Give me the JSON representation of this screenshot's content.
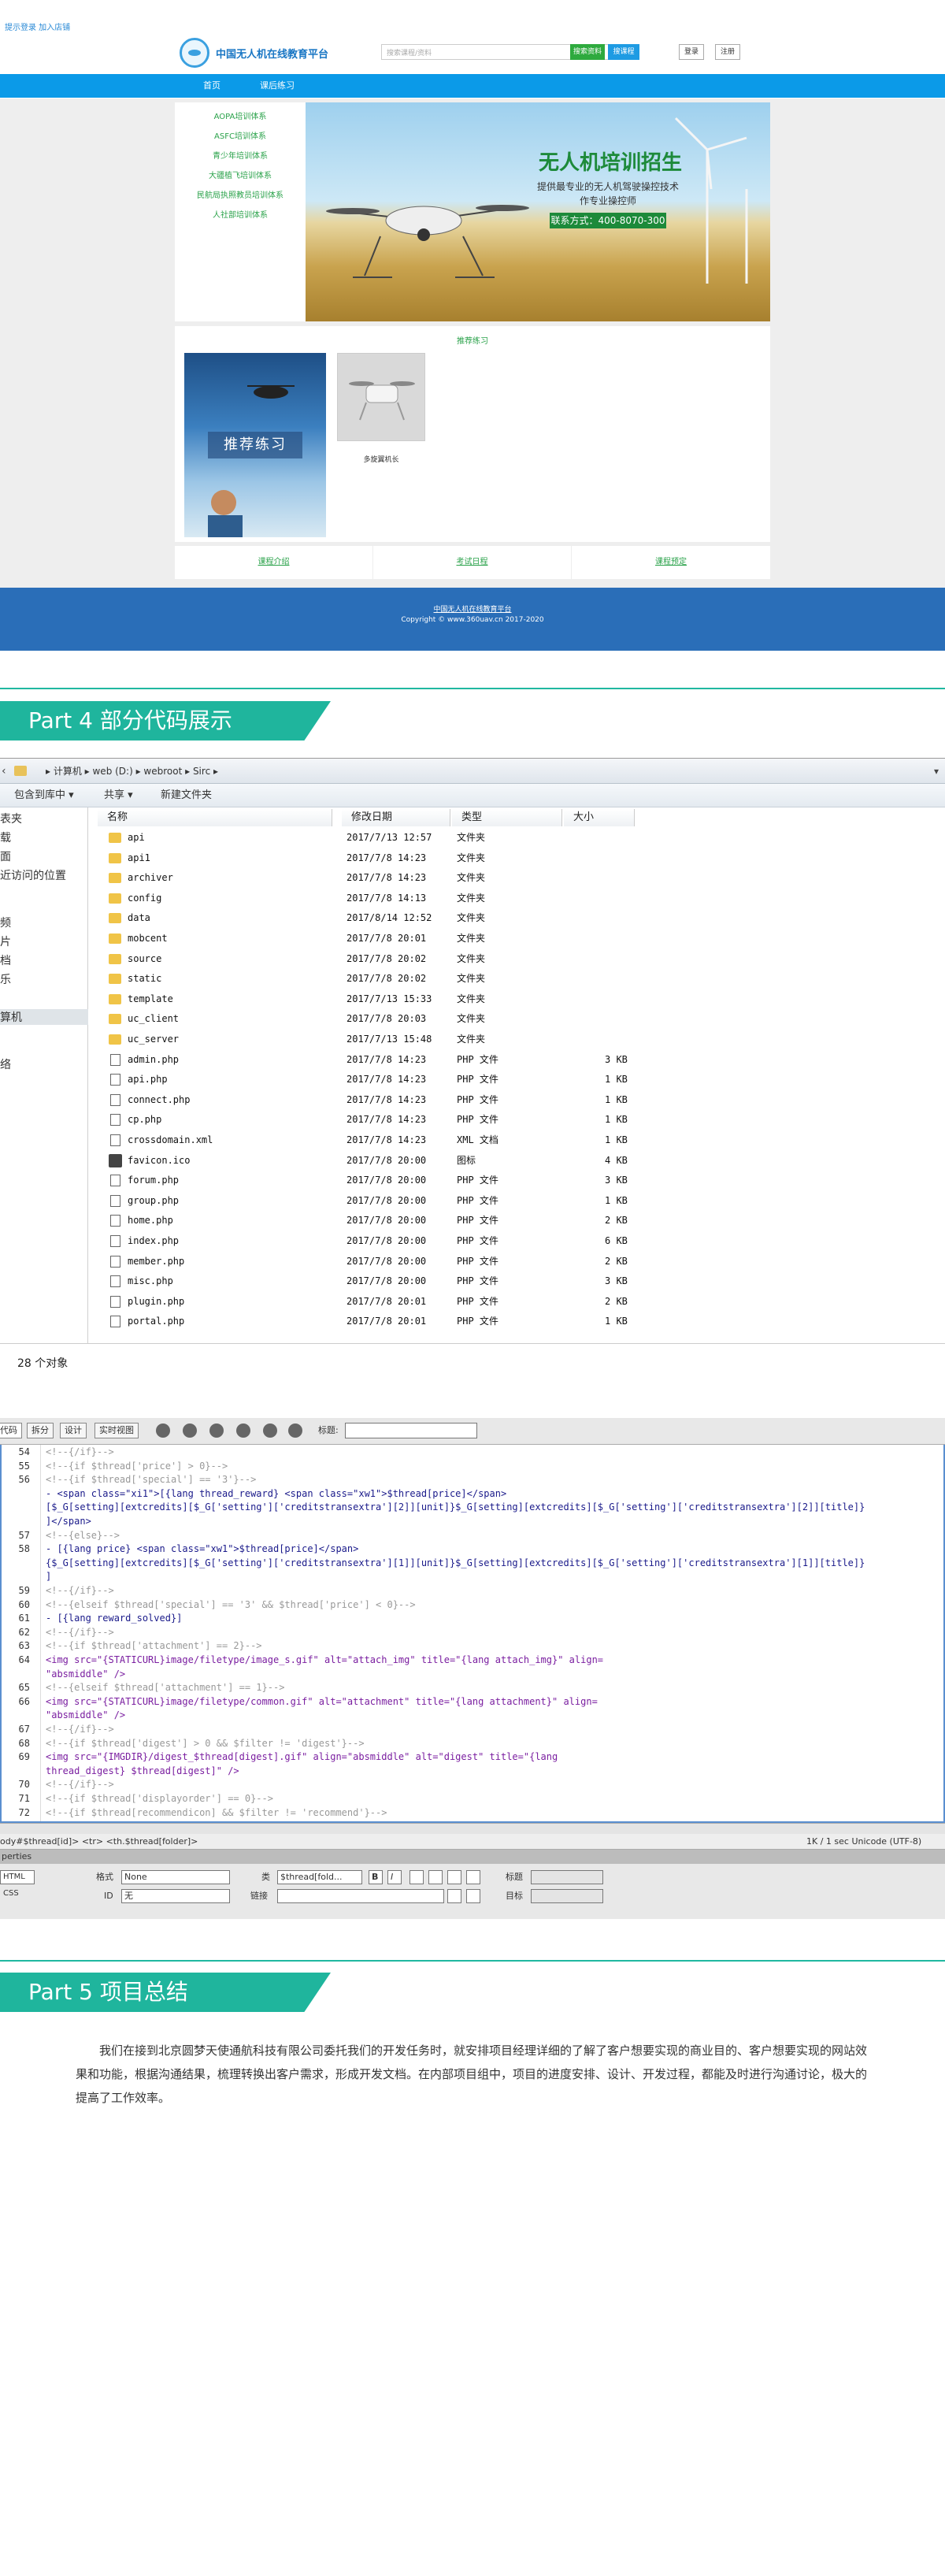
{
  "site": {
    "topbar": "提示登录 加入店铺",
    "logo_text": "中国无人机在线教育平台",
    "search_placeholder": "搜索课程/资料",
    "search_button": "搜索资料",
    "search_button2": "搜课程",
    "login": "登录",
    "register": "注册",
    "nav": [
      "首页",
      "课后练习"
    ],
    "side_menu": [
      "AOPA培训体系",
      "ASFC培训体系",
      "青少年培训体系",
      "大疆植飞培训体系",
      "民航局执照教员培训体系",
      "人社部培训体系"
    ],
    "banner": {
      "title": "无人机培训招生",
      "subtitle1": "提供最专业的无人机驾驶操控技术",
      "subtitle2": "作专业操控师",
      "phone": "联系方式：400-8070-300"
    },
    "recommend_title": "推荐练习",
    "poster_label": "推荐练习",
    "card_label": "多旋翼机长",
    "links": [
      "课程介绍",
      "考试日程",
      "课程预定"
    ],
    "footer1": "中国无人机在线教育平台",
    "footer2": "Copyright © www.360uav.cn 2017-2020"
  },
  "part4": {
    "title": "Part 4  部分代码展示"
  },
  "explorer": {
    "back": "‹",
    "breadcrumb": "▸ 计算机 ▸ web (D:) ▸ webroot ▸ Sirc ▸",
    "dropdown": "▾",
    "toolbar": [
      "包含到库中 ▾",
      "共享 ▾",
      "新建文件夹"
    ],
    "tree": [
      "表夹",
      "载",
      "面",
      "近访问的位置",
      "频",
      "片",
      "档",
      "乐",
      "算机",
      "络"
    ],
    "columns": [
      "名称",
      "修改日期",
      "类型",
      "大小"
    ],
    "files": [
      {
        "icon": "folder",
        "name": "api",
        "date": "2017/7/13 12:57",
        "type": "文件夹",
        "size": ""
      },
      {
        "icon": "folder",
        "name": "api1",
        "date": "2017/7/8 14:23",
        "type": "文件夹",
        "size": ""
      },
      {
        "icon": "folder",
        "name": "archiver",
        "date": "2017/7/8 14:23",
        "type": "文件夹",
        "size": ""
      },
      {
        "icon": "folder",
        "name": "config",
        "date": "2017/7/8 14:13",
        "type": "文件夹",
        "size": ""
      },
      {
        "icon": "folder",
        "name": "data",
        "date": "2017/8/14 12:52",
        "type": "文件夹",
        "size": ""
      },
      {
        "icon": "folder",
        "name": "mobcent",
        "date": "2017/7/8 20:01",
        "type": "文件夹",
        "size": ""
      },
      {
        "icon": "folder",
        "name": "source",
        "date": "2017/7/8 20:02",
        "type": "文件夹",
        "size": ""
      },
      {
        "icon": "folder",
        "name": "static",
        "date": "2017/7/8 20:02",
        "type": "文件夹",
        "size": ""
      },
      {
        "icon": "folder",
        "name": "template",
        "date": "2017/7/13 15:33",
        "type": "文件夹",
        "size": ""
      },
      {
        "icon": "folder",
        "name": "uc_client",
        "date": "2017/7/8 20:03",
        "type": "文件夹",
        "size": ""
      },
      {
        "icon": "folder",
        "name": "uc_server",
        "date": "2017/7/13 15:48",
        "type": "文件夹",
        "size": ""
      },
      {
        "icon": "file",
        "name": "admin.php",
        "date": "2017/7/8 14:23",
        "type": "PHP 文件",
        "size": "3 KB"
      },
      {
        "icon": "file",
        "name": "api.php",
        "date": "2017/7/8 14:23",
        "type": "PHP 文件",
        "size": "1 KB"
      },
      {
        "icon": "file",
        "name": "connect.php",
        "date": "2017/7/8 14:23",
        "type": "PHP 文件",
        "size": "1 KB"
      },
      {
        "icon": "file",
        "name": "cp.php",
        "date": "2017/7/8 14:23",
        "type": "PHP 文件",
        "size": "1 KB"
      },
      {
        "icon": "file",
        "name": "crossdomain.xml",
        "date": "2017/7/8 14:23",
        "type": "XML 文档",
        "size": "1 KB"
      },
      {
        "icon": "fav",
        "name": "favicon.ico",
        "date": "2017/7/8 20:00",
        "type": "图标",
        "size": "4 KB"
      },
      {
        "icon": "file",
        "name": "forum.php",
        "date": "2017/7/8 20:00",
        "type": "PHP 文件",
        "size": "3 KB"
      },
      {
        "icon": "file",
        "name": "group.php",
        "date": "2017/7/8 20:00",
        "type": "PHP 文件",
        "size": "1 KB"
      },
      {
        "icon": "file",
        "name": "home.php",
        "date": "2017/7/8 20:00",
        "type": "PHP 文件",
        "size": "2 KB"
      },
      {
        "icon": "file",
        "name": "index.php",
        "date": "2017/7/8 20:00",
        "type": "PHP 文件",
        "size": "6 KB"
      },
      {
        "icon": "file",
        "name": "member.php",
        "date": "2017/7/8 20:00",
        "type": "PHP 文件",
        "size": "2 KB"
      },
      {
        "icon": "file",
        "name": "misc.php",
        "date": "2017/7/8 20:00",
        "type": "PHP 文件",
        "size": "3 KB"
      },
      {
        "icon": "file",
        "name": "plugin.php",
        "date": "2017/7/8 20:01",
        "type": "PHP 文件",
        "size": "2 KB"
      },
      {
        "icon": "file",
        "name": "portal.php",
        "date": "2017/7/8 20:01",
        "type": "PHP 文件",
        "size": "1 KB"
      }
    ],
    "status": "28 个对象"
  },
  "editor": {
    "tabs": [
      "代码",
      "拆分",
      "设计",
      "实时视图"
    ],
    "title_label": "标题:",
    "lines": [
      {
        "n": "54",
        "t": "<!--{/if}-->",
        "c": "c-gray"
      },
      {
        "n": "55",
        "t": "                                             <!--{if $thread['price'] > 0}-->",
        "c": "c-gray"
      },
      {
        "n": "56",
        "t": "                                                 <!--{if $thread['special'] == '3'}-->",
        "c": "c-gray"
      },
      {
        "n": "",
        "t": "                                                 - <span class=\"xi1\">[{lang thread_reward} <span class=\"xw1\">$thread[price]</span>",
        "c": "c-navy"
      },
      {
        "n": "",
        "t": "[$_G[setting][extcredits][$_G['setting']['creditstransextra'][2]][unit]}$_G[setting][extcredits][$_G['setting']['creditstransextra'][2]][title]}",
        "c": "c-navy"
      },
      {
        "n": "",
        "t": "]</span>",
        "c": "c-navy"
      },
      {
        "n": "57",
        "t": "                                                 <!--{else}-->",
        "c": "c-gray"
      },
      {
        "n": "58",
        "t": "                                                 - [{lang price} <span class=\"xw1\">$thread[price]</span>",
        "c": "c-navy"
      },
      {
        "n": "",
        "t": "{$_G[setting][extcredits][$_G['setting']['creditstransextra'][1]][unit]}$_G[setting][extcredits][$_G['setting']['creditstransextra'][1]][title]}",
        "c": "c-navy"
      },
      {
        "n": "",
        "t": "]",
        "c": "c-navy"
      },
      {
        "n": "59",
        "t": "                                                 <!--{/if}-->",
        "c": "c-gray"
      },
      {
        "n": "60",
        "t": "                                             <!--{elseif $thread['special'] == '3' && $thread['price'] < 0}-->",
        "c": "c-gray"
      },
      {
        "n": "61",
        "t": "                                                 - [{lang reward_solved}]",
        "c": "c-navy"
      },
      {
        "n": "62",
        "t": "                                             <!--{/if}-->",
        "c": "c-gray"
      },
      {
        "n": "63",
        "t": "                                             <!--{if $thread['attachment'] == 2}-->",
        "c": "c-gray"
      },
      {
        "n": "64",
        "t": "                                                 <img src=\"{STATICURL}image/filetype/image_s.gif\" alt=\"attach_img\" title=\"{lang attach_img}\" align=",
        "c": "c-purple"
      },
      {
        "n": "",
        "t": "\"absmiddle\" />",
        "c": "c-purple"
      },
      {
        "n": "65",
        "t": "                                             <!--{elseif $thread['attachment'] == 1}-->",
        "c": "c-gray"
      },
      {
        "n": "66",
        "t": "                                                 <img src=\"{STATICURL}image/filetype/common.gif\" alt=\"attachment\" title=\"{lang attachment}\" align=",
        "c": "c-purple"
      },
      {
        "n": "",
        "t": "\"absmiddle\" />",
        "c": "c-purple"
      },
      {
        "n": "67",
        "t": "                                             <!--{/if}-->",
        "c": "c-gray"
      },
      {
        "n": "68",
        "t": "                                             <!--{if $thread['digest'] > 0 && $filter != 'digest'}-->",
        "c": "c-gray"
      },
      {
        "n": "69",
        "t": "                                                 <img src=\"{IMGDIR}/digest_$thread[digest].gif\" align=\"absmiddle\" alt=\"digest\" title=\"{lang",
        "c": "c-purple"
      },
      {
        "n": "",
        "t": "thread_digest} $thread[digest]\" />",
        "c": "c-purple"
      },
      {
        "n": "70",
        "t": "                                             <!--{/if}-->",
        "c": "c-gray"
      },
      {
        "n": "71",
        "t": "                                             <!--{if $thread['displayorder'] == 0}-->",
        "c": "c-gray"
      },
      {
        "n": "72",
        "t": "                                                 <!--{if $thread[recommendicon] && $filter != 'recommend'}-->",
        "c": "c-gray"
      }
    ],
    "status_left": "ody#$thread[id]> <tr> <th.$thread[folder]>",
    "status_right": "1K / 1 sec   Unicode (UTF-8)",
    "prop_title": "perties",
    "prop": {
      "html": "HTML",
      "css": "CSS",
      "format_label": "格式",
      "format_value": "None",
      "class_label": "类",
      "class_value": "$thread[fold...",
      "id_label": "ID",
      "id_value": "无",
      "link_label": "链接",
      "title_label": "标题",
      "target_label": "目标",
      "bold": "B",
      "italic": "I"
    }
  },
  "part5": {
    "title": "Part 5  项目总结"
  },
  "summary": "我们在接到北京圆梦天使通航科技有限公司委托我们的开发任务时，就安排项目经理详细的了解了客户想要实现的商业目的、客户想要实现的网站效果和功能，根据沟通结果，梳理转换出客户需求，形成开发文档。在内部项目组中，项目的进度安排、设计、开发过程，都能及时进行沟通讨论，极大的提高了工作效率。"
}
